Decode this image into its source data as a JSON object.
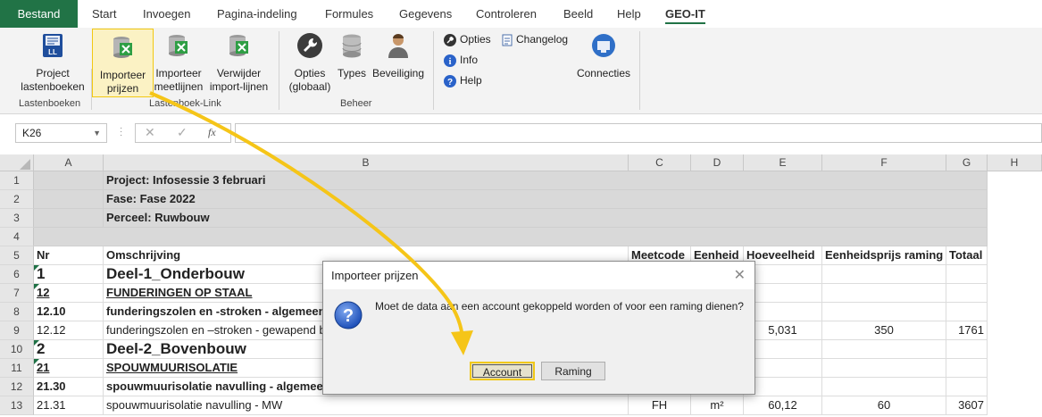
{
  "tabs": [
    "Bestand",
    "Start",
    "Invoegen",
    "Pagina-indeling",
    "Formules",
    "Gegevens",
    "Controleren",
    "Beeld",
    "Help",
    "GEO-IT"
  ],
  "ribbon": {
    "project_l1": "Project",
    "project_l2": "lastenboeken",
    "import_prices_l1": "Importeer",
    "import_prices_l2": "prijzen",
    "import_lines_l1": "Importeer",
    "import_lines_l2": "meetlijnen",
    "remove_l1": "Verwijder",
    "remove_l2": "import-lijnen",
    "options_l1": "Opties",
    "options_l2": "(globaal)",
    "types": "Types",
    "security": "Beveiliging",
    "opties": "Opties",
    "changelog": "Changelog",
    "info": "Info",
    "help": "Help",
    "connecties": "Connecties",
    "group_lastenboeken": "Lastenboeken",
    "group_link": "Lastenboek-Link",
    "group_beheer": "Beheer"
  },
  "formula": {
    "cell_ref": "K26",
    "fx": "fx",
    "value": ""
  },
  "columns": [
    "A",
    "B",
    "C",
    "D",
    "E",
    "F",
    "G",
    "H"
  ],
  "rows": [
    {
      "n": "1",
      "a": "",
      "b": "Project: Infosessie 3 februari"
    },
    {
      "n": "2",
      "a": "",
      "b": "Fase: Fase 2022"
    },
    {
      "n": "3",
      "a": "",
      "b": "Perceel: Ruwbouw"
    },
    {
      "n": "4",
      "a": "",
      "b": ""
    },
    {
      "n": "5",
      "a": "Nr",
      "b": "Omschrijving",
      "c": "Meetcode",
      "d": "Eenheid",
      "e": "Hoeveelheid",
      "f": "Eenheidsprijs raming",
      "g": "Totaal"
    },
    {
      "n": "6",
      "a": "1",
      "b": "Deel-1_Onderbouw"
    },
    {
      "n": "7",
      "a": "12",
      "b": "FUNDERINGEN OP STAAL"
    },
    {
      "n": "8",
      "a": "12.10",
      "b": "funderingszolen en -stroken - algemeen"
    },
    {
      "n": "9",
      "a": "12.12",
      "b": "funderingszolen en –stroken - gewapend beton",
      "e": "5,031",
      "f": "350",
      "g": "1761"
    },
    {
      "n": "10",
      "a": "2",
      "b": "Deel-2_Bovenbouw"
    },
    {
      "n": "11",
      "a": "21",
      "b": "SPOUWMUURISOLATIE"
    },
    {
      "n": "12",
      "a": "21.30",
      "b": "spouwmuurisolatie navulling - algemeen"
    },
    {
      "n": "13",
      "a": "21.31",
      "b": "spouwmuurisolatie navulling - MW",
      "c": "FH",
      "d": "m²",
      "e": "60,12",
      "f": "60",
      "g": "3607"
    }
  ],
  "dialog": {
    "title": "Importeer prijzen",
    "message": "Moet de data aan een account gekoppeld worden of voor een raming dienen?",
    "btn_account": "Account",
    "btn_raming": "Raming"
  },
  "colors": {
    "excel_green": "#217346",
    "highlight": "#f2c811",
    "arrow": "#f5c518"
  }
}
